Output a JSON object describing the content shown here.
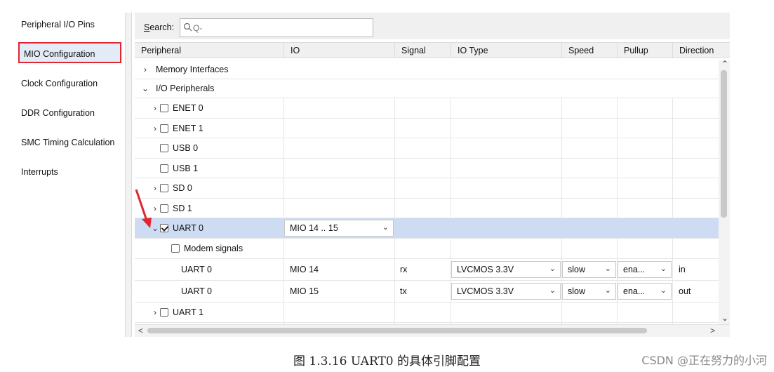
{
  "sidebar": {
    "items": [
      {
        "label": "Peripheral I/O Pins",
        "active": false
      },
      {
        "label": "MIO Configuration",
        "active": true
      },
      {
        "label": "Clock Configuration",
        "active": false
      },
      {
        "label": "DDR Configuration",
        "active": false
      },
      {
        "label": "SMC Timing Calculation",
        "active": false
      },
      {
        "label": "Interrupts",
        "active": false
      }
    ]
  },
  "search": {
    "label_accel": "S",
    "label_rest": "earch:",
    "placeholder": "Q-"
  },
  "columns": [
    "Peripheral",
    "IO",
    "Signal",
    "IO Type",
    "Speed",
    "Pullup",
    "Direction"
  ],
  "rows": [
    {
      "expand": ">",
      "label": "Memory Interfaces"
    },
    {
      "expand": "v",
      "label": "I/O Peripherals"
    },
    {
      "expand": ">",
      "checked": false,
      "label": "ENET 0"
    },
    {
      "expand": ">",
      "checked": false,
      "label": "ENET 1"
    },
    {
      "checked": false,
      "label": "USB 0"
    },
    {
      "checked": false,
      "label": "USB 1"
    },
    {
      "expand": ">",
      "checked": false,
      "label": "SD 0"
    },
    {
      "expand": ">",
      "checked": false,
      "label": "SD 1"
    },
    {
      "expand": "v",
      "checked": true,
      "label": "UART 0",
      "io": "MIO 14 .. 15",
      "selected": true
    },
    {
      "checked": false,
      "label": "Modem signals"
    },
    {
      "label": "UART 0",
      "io": "MIO 14",
      "signal": "rx",
      "io_type": "LVCMOS 3.3V",
      "speed": "slow",
      "pullup": "ena...",
      "direction": "in"
    },
    {
      "label": "UART 0",
      "io": "MIO 15",
      "signal": "tx",
      "io_type": "LVCMOS 3.3V",
      "speed": "slow",
      "pullup": "ena...",
      "direction": "out"
    },
    {
      "expand": ">",
      "checked": false,
      "label": "UART 1"
    }
  ],
  "caption": "图 1.3.16 UART0 的具体引脚配置",
  "watermark": "CSDN @正在努力的小河",
  "colors": {
    "selected_row": "#cddcf3",
    "highlight_border": "#e0262e",
    "annotation_arrow": "#e0262e"
  },
  "icons": {
    "search": "search-icon",
    "expand": "chevron-right-icon",
    "collapse": "chevron-down-icon",
    "dropdown": "chevron-down-icon"
  }
}
